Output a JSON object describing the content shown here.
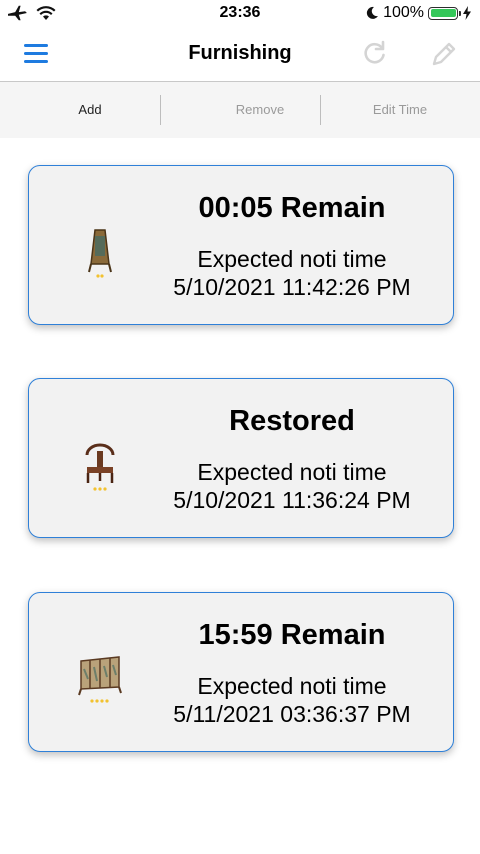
{
  "status_bar": {
    "time": "23:36",
    "battery": "100%"
  },
  "navbar": {
    "title": "Furnishing"
  },
  "toolbar": {
    "add": "Add",
    "remove": "Remove",
    "edit_time": "Edit Time"
  },
  "cards": [
    {
      "status": "00:05 Remain",
      "label": "Expected noti time",
      "datetime": "5/10/2021 11:42:26 PM",
      "thumb": "easel-icon"
    },
    {
      "status": "Restored",
      "label": "Expected noti time",
      "datetime": "5/10/2021 11:36:24 PM",
      "thumb": "chair-icon"
    },
    {
      "status": "15:59 Remain",
      "label": "Expected noti time",
      "datetime": "5/11/2021 03:36:37 PM",
      "thumb": "folding-screen-icon"
    }
  ],
  "colors": {
    "accent": "#1e7be0",
    "card_border": "#2f80d8",
    "card_bg": "#f2f2f2",
    "battery": "#34c759"
  }
}
